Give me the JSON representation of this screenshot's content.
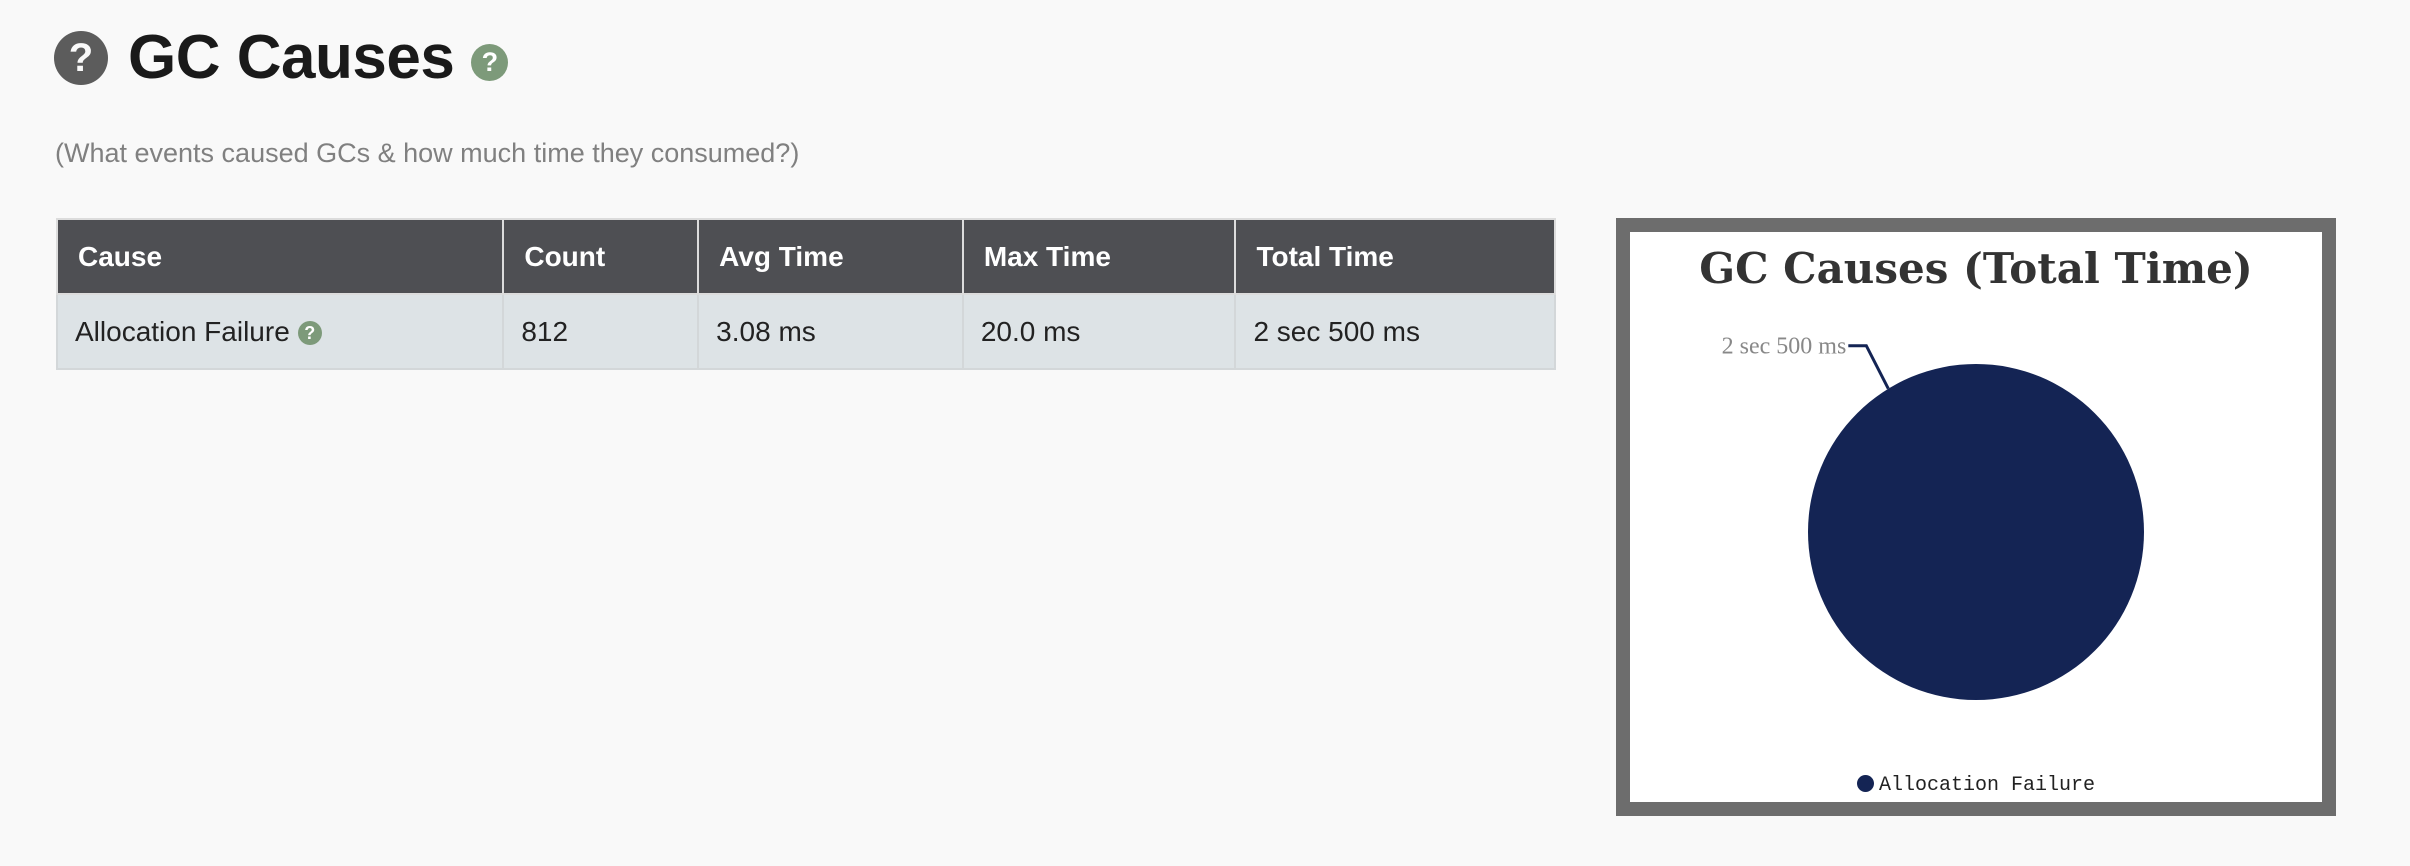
{
  "header": {
    "help_icon_glyph": "?",
    "title": "GC Causes",
    "title_help_glyph": "?",
    "subtitle": "(What events caused GCs & how much time they consumed?)"
  },
  "table": {
    "columns": [
      "Cause",
      "Count",
      "Avg Time",
      "Max Time",
      "Total Time"
    ],
    "rows": [
      {
        "cause": "Allocation Failure",
        "help_glyph": "?",
        "count": "812",
        "avg_time": "3.08 ms",
        "max_time": "20.0 ms",
        "total_time": "2 sec 500 ms"
      }
    ]
  },
  "chart_data": {
    "type": "pie",
    "title": "GC Causes (Total Time)",
    "slices": [
      {
        "name": "Allocation Failure",
        "value": 2500,
        "label": "2 sec 500 ms",
        "color": "#142454"
      }
    ],
    "legend_placement": "bottom",
    "legend": [
      "Allocation Failure"
    ]
  },
  "colors": {
    "header_bg": "#4e4f53",
    "row_bg": "#dde3e6",
    "help_green": "#7d9a7a",
    "help_dark": "#5c5c5c",
    "pie_color": "#142454",
    "frame": "#6d6d6d"
  }
}
